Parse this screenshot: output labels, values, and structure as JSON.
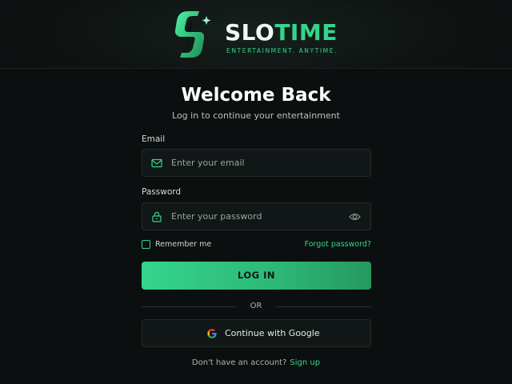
{
  "brand": {
    "name_part1": "SLO",
    "name_part2": "TIME",
    "tagline": "ENTERTAINMENT. ANYTIME.",
    "accent_color": "#35d58a",
    "logo_icon": "s-dollar-sparkle-logo"
  },
  "heading": {
    "title": "Welcome Back",
    "subtitle": "Log in to continue your entertainment"
  },
  "form": {
    "email": {
      "label": "Email",
      "placeholder": "Enter your email",
      "icon": "mail-icon"
    },
    "password": {
      "label": "Password",
      "placeholder": "Enter your password",
      "icon": "lock-icon",
      "toggle_icon": "eye-icon"
    },
    "remember_label": "Remember me",
    "remember_checked": false,
    "forgot_label": "Forgot password?",
    "login_label": "LOG IN",
    "divider_label": "OR",
    "google_label": "Continue with Google",
    "google_icon": "google-icon"
  },
  "footer": {
    "prompt": "Don't have an account?",
    "signup_label": "Sign up"
  }
}
